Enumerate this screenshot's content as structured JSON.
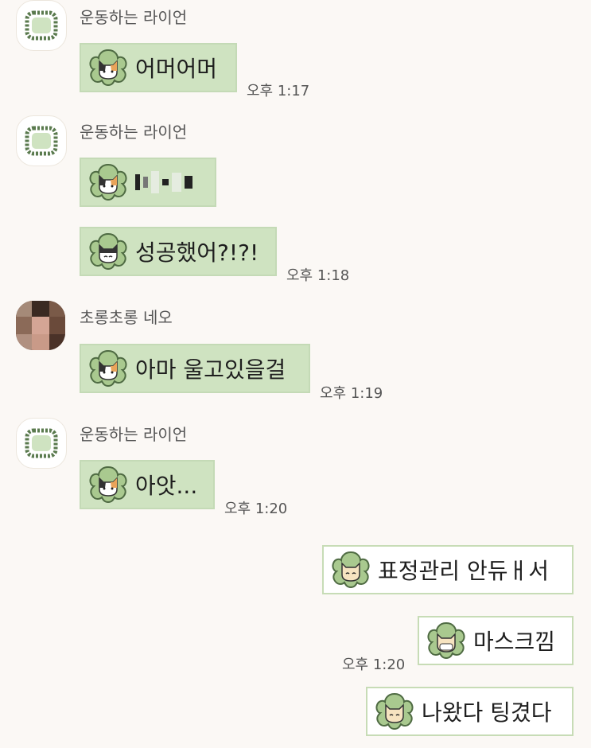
{
  "colors": {
    "background": "#fbf8f5",
    "bubble_other": "#cfe3c1",
    "bubble_me": "#ffffff",
    "bubble_border": "#c4dab6"
  },
  "messages": {
    "m1": {
      "sender": "운동하는 라이언",
      "text": "어머어머",
      "time": "오후 1:17",
      "emoticon": "calico-cat-icon"
    },
    "m2": {
      "sender": "운동하는 라이언",
      "text": "",
      "emoticon": "calico-cat-icon",
      "note": "censored"
    },
    "m3": {
      "text": "성공했어?!?!",
      "time": "오후 1:18",
      "emoticon": "black-white-cat-icon"
    },
    "m4": {
      "sender": "초롱초롱 네오",
      "text": "아마 울고있을걸",
      "time": "오후 1:19",
      "emoticon": "calico-cat-icon"
    },
    "m5": {
      "sender": "운동하는 라이언",
      "text": "아앗...",
      "time": "오후 1:20",
      "emoticon": "calico-cat-icon"
    },
    "m6": {
      "text": "표정관리 안듀ㅐ서",
      "emoticon": "cream-cat-icon"
    },
    "m7": {
      "text": "마스크낌",
      "time": "오후 1:20",
      "emoticon": "cream-cat-icon"
    },
    "m8": {
      "text": "나왔다 팅겼다",
      "emoticon": "cream-cat-icon"
    }
  }
}
